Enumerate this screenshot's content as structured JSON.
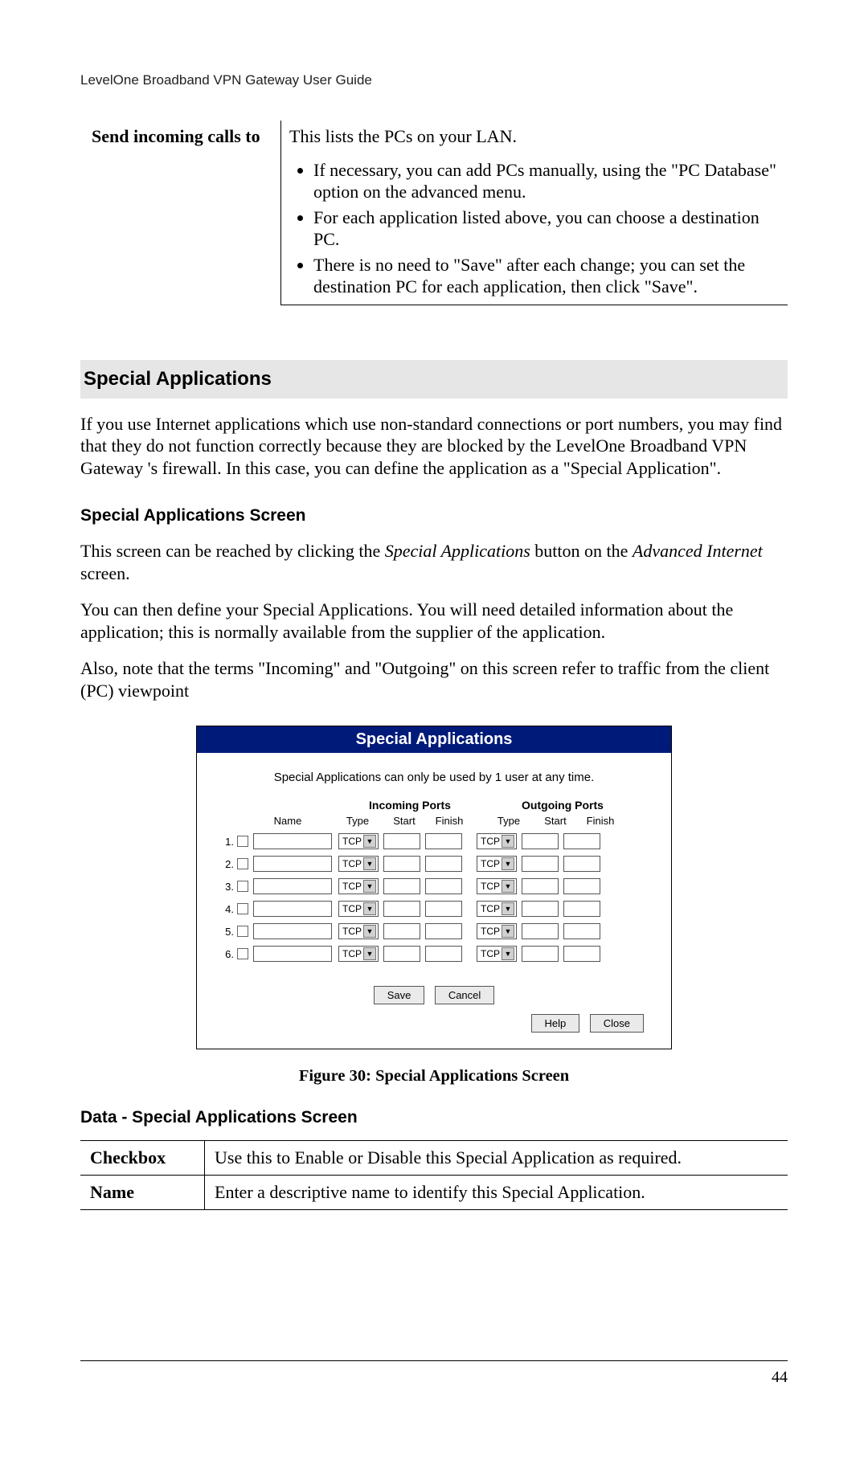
{
  "header": "LevelOne Broadband VPN Gateway User Guide",
  "page_number": "44",
  "top_table": {
    "label": "Send incoming calls to",
    "intro": "This lists the PCs on your LAN.",
    "bullets": [
      "If necessary, you can add PCs manually, using the \"PC Database\" option on the advanced menu.",
      "For each application listed above, you can choose a destination PC.",
      "There is no need to \"Save\" after each change; you can set the destination PC for each application, then click \"Save\"."
    ]
  },
  "section_heading": "Special Applications",
  "para1": "If you use Internet applications which use non-standard connections or port numbers, you may find that they do not function correctly because they are blocked by the LevelOne Broadband VPN Gateway 's firewall. In this case, you can define the application as a \"Special Application\".",
  "subheading1": "Special Applications Screen",
  "para2a": "This screen can be reached by clicking the ",
  "para2_em1": "Special Applications",
  "para2b": " button on the ",
  "para2_em2": "Advanced Internet",
  "para2c": " screen.",
  "para3": "You can then define your Special Applications. You will need detailed information about the application; this is normally available from the supplier of the application.",
  "para4": "Also, note that the terms \"Incoming\" and \"Outgoing\" on this screen refer to traffic from the client (PC) viewpoint",
  "fig": {
    "title": "Special Applications",
    "note": "Special Applications can only be used by 1 user at any time.",
    "group_in": "Incoming Ports",
    "group_out": "Outgoing Ports",
    "col_name": "Name",
    "col_type": "Type",
    "col_start": "Start",
    "col_finish": "Finish",
    "type_value": "TCP",
    "rows": [
      "1.",
      "2.",
      "3.",
      "4.",
      "5.",
      "6."
    ],
    "btn_save": "Save",
    "btn_cancel": "Cancel",
    "btn_help": "Help",
    "btn_close": "Close"
  },
  "figure_caption": "Figure 30: Special Applications Screen",
  "subheading2": "Data - Special Applications Screen",
  "data_table": {
    "row1_label": "Checkbox",
    "row1_text": "Use this to Enable or Disable this Special Application as required.",
    "row2_label": "Name",
    "row2_text": "Enter a descriptive name to identify this Special Application."
  }
}
